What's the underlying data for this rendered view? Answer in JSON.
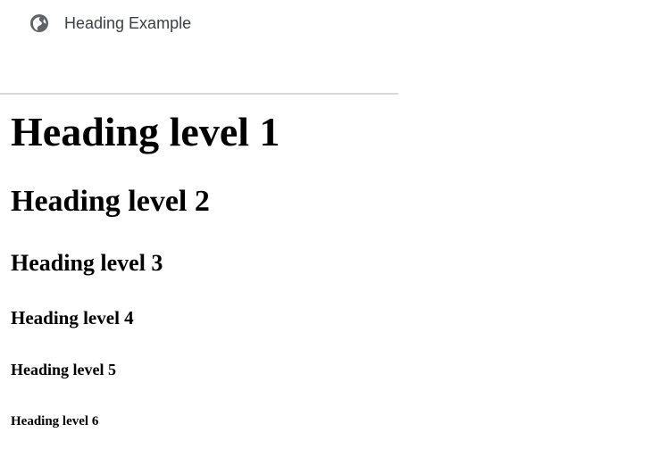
{
  "tab": {
    "icon": "globe-icon",
    "title": "Heading Example"
  },
  "headings": {
    "h1": "Heading level 1",
    "h2": "Heading level 2",
    "h3": "Heading level 3",
    "h4": "Heading level 4",
    "h5": "Heading level 5",
    "h6": "Heading level 6"
  },
  "colors": {
    "chrome_background": "#ffffff",
    "chrome_divider": "#d9d9d9",
    "tab_text": "#3c4043",
    "icon": "#5f6368",
    "heading_text": "#000000"
  }
}
